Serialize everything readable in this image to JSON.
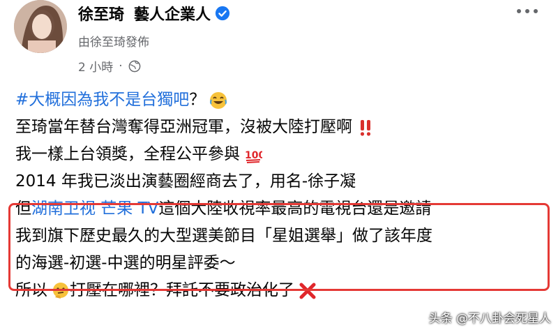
{
  "post": {
    "author_name": "徐至琦",
    "author_role": "藝人企業人",
    "byline": "由徐至琦發佈",
    "time": "2 小時",
    "separator": "·"
  },
  "content": {
    "hashtag": "#大概因為我不是台獨吧",
    "hashtag_tail": "？",
    "line2": "至琦當年替台灣奪得亞洲冠軍，沒被大陸打壓啊",
    "line3": "我一樣上台領獎，全程公平參與",
    "line4": "2014 年我已淡出演藝圈經商去了，用名-徐子凝",
    "line5_pre": "但",
    "line5_link": "湖南卫视 芒果 TV",
    "line5_post": "這個大陸收視率最高的電視台還是邀請",
    "line6": "我到旗下歷史最久的大型選美節目「星姐選舉」做了該年度",
    "line7": "的海選-初選-中選的明星評委～",
    "line8_pre": "所以",
    "line8_post": "打壓在哪裡？拜託不要政治化了"
  },
  "watermark": "头条 @不八卦会死星人",
  "icons": {
    "verified": "verified-badge-icon",
    "globe": "globe-icon",
    "more": "more-options-icon",
    "laugh": "laughing-emoji-icon",
    "exclaim": "double-exclamation-icon",
    "hundred": "hundred-points-emoji-icon",
    "thinking": "thinking-emoji-icon",
    "cross": "cross-mark-icon"
  },
  "colors": {
    "link": "#216fdb",
    "highlight_border": "#e53935",
    "meta_gray": "#65676b"
  }
}
